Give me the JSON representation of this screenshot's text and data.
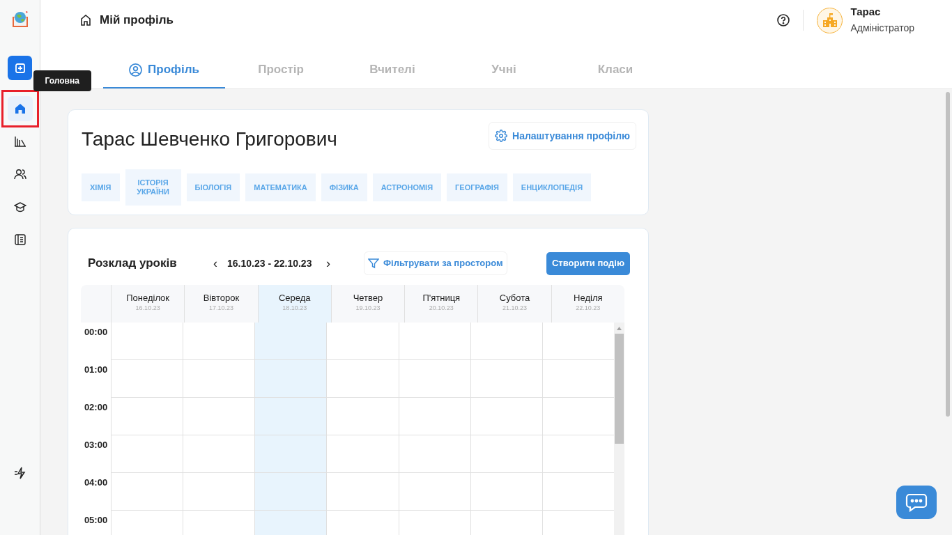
{
  "header": {
    "title": "Мій профіль",
    "user": {
      "name": "Тарас",
      "role": "Адміністратор"
    }
  },
  "sidebar": {
    "items": [
      {
        "kind": "add",
        "selected": false
      },
      {
        "kind": "home",
        "selected": true,
        "tooltip": "Головна"
      },
      {
        "kind": "books",
        "selected": false
      },
      {
        "kind": "users",
        "selected": false
      },
      {
        "kind": "graduation",
        "selected": false
      },
      {
        "kind": "journal",
        "selected": false
      }
    ]
  },
  "tabs": [
    {
      "label": "Профіль",
      "selected": true
    },
    {
      "label": "Простір",
      "selected": false
    },
    {
      "label": "Вчителі",
      "selected": false
    },
    {
      "label": "Учні",
      "selected": false
    },
    {
      "label": "Класи",
      "selected": false
    }
  ],
  "profile": {
    "name": "Тарас Шевченко Григорович",
    "settings_button": "Налаштування профілю",
    "subjects": [
      "ХІМІЯ",
      "ІСТОРІЯ УКРАЇНИ",
      "БІОЛОГІЯ",
      "МАТЕМАТИКА",
      "ФІЗИКА",
      "АСТРОНОМІЯ",
      "ГЕОГРАФІЯ",
      "ЕНЦИКЛОПЕДІЯ"
    ]
  },
  "schedule": {
    "title": "Розклад уроків",
    "prev": "‹",
    "range": "16.10.23 - 22.10.23",
    "next": "›",
    "filter_button": "Фільтрувати за простором",
    "create_button": "Створити подію",
    "days": [
      {
        "name": "Понеділок",
        "date": "16.10.23",
        "selected": false
      },
      {
        "name": "Вівторок",
        "date": "17.10.23",
        "selected": false
      },
      {
        "name": "Середа",
        "date": "18.10.23",
        "selected": true
      },
      {
        "name": "Четвер",
        "date": "19.10.23",
        "selected": false
      },
      {
        "name": "П'ятниця",
        "date": "20.10.23",
        "selected": false
      },
      {
        "name": "Субота",
        "date": "21.10.23",
        "selected": false
      },
      {
        "name": "Неділя",
        "date": "22.10.23",
        "selected": false
      }
    ],
    "hours": [
      "00:00",
      "01:00",
      "02:00",
      "03:00",
      "04:00",
      "05:00"
    ]
  }
}
